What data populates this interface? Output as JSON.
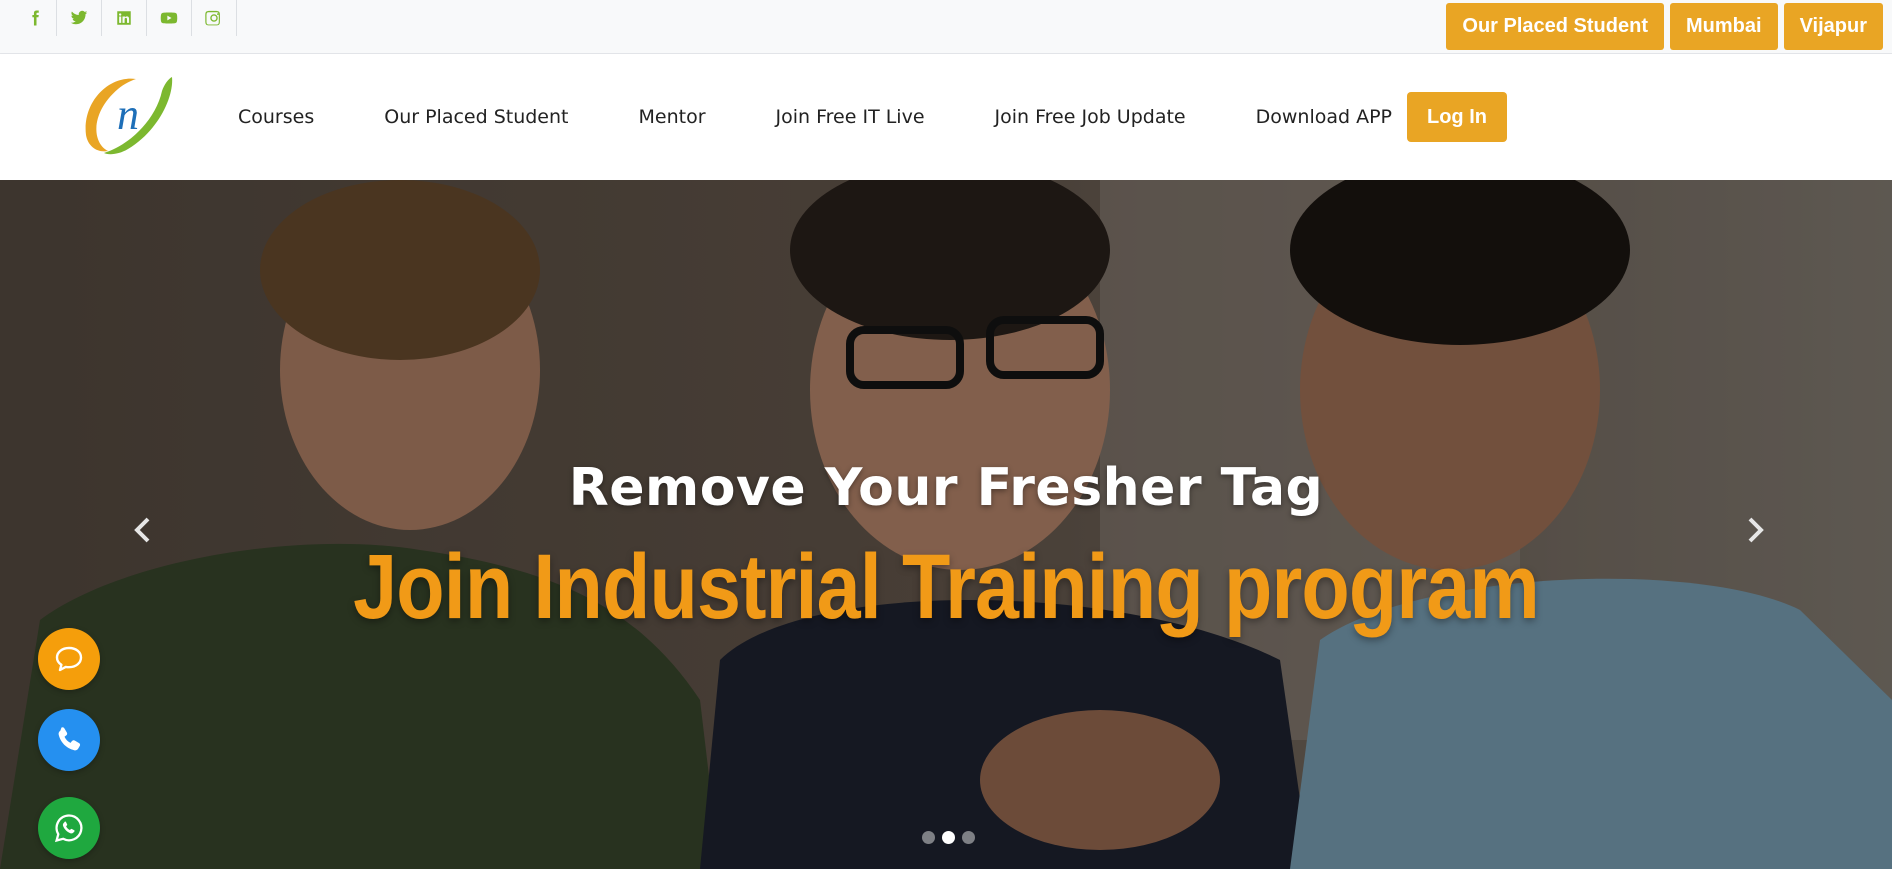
{
  "topbar": {
    "social_icons": [
      "facebook-icon",
      "twitter-icon",
      "linkedin-icon",
      "youtube-icon",
      "instagram-icon"
    ],
    "buttons": [
      "Our Placed Student",
      "Mumbai",
      "Vijapur"
    ]
  },
  "navbar": {
    "logo_text": "n",
    "items": [
      "Courses",
      "Our Placed Student",
      "Mentor",
      "Join Free IT Live",
      "Join Free Job Update",
      "Download APP"
    ],
    "login_label": "Log In"
  },
  "hero": {
    "subtitle": "Remove Your Fresher Tag",
    "title": "Join Industrial Training program",
    "slide_count": 3,
    "active_slide": 2
  },
  "floating": {
    "icons": [
      "chat-icon",
      "phone-icon",
      "whatsapp-icon"
    ]
  },
  "colors": {
    "accent": "#e9a524",
    "social_green": "#7cb82f",
    "hero_title": "#f19a17",
    "chat_bg": "#f59e0b",
    "phone_bg": "#2590f0",
    "whatsapp_bg": "#1fa83f"
  }
}
